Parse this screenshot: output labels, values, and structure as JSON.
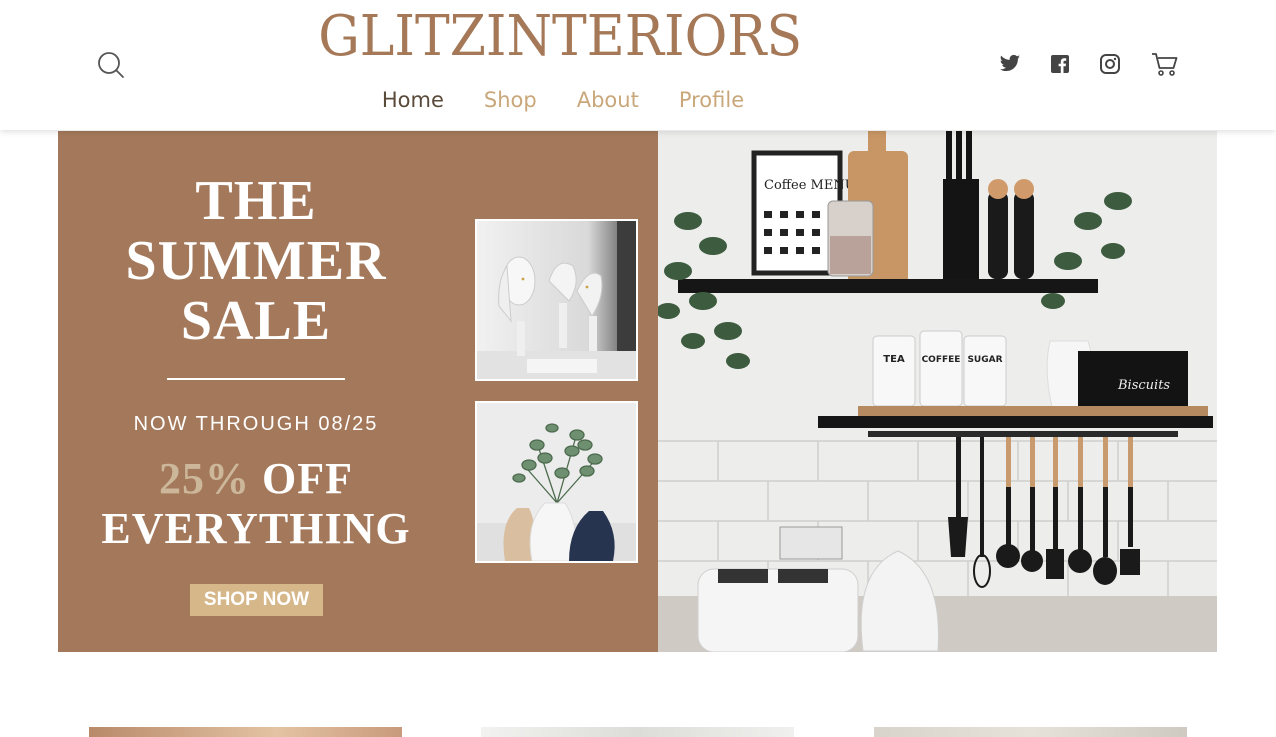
{
  "brand": {
    "logo_text": "GLITZINTERIORS"
  },
  "nav": {
    "items": [
      {
        "label": "Home",
        "active": true
      },
      {
        "label": "Shop",
        "active": false
      },
      {
        "label": "About",
        "active": false
      },
      {
        "label": "Profile",
        "active": false
      }
    ]
  },
  "header_icons": [
    "search-icon",
    "twitter-icon",
    "facebook-icon",
    "instagram-icon",
    "cart-icon"
  ],
  "hero": {
    "title_line1": "THE",
    "title_line2": "SUMMER",
    "title_line3": "SALE",
    "date_text": "NOW THROUGH 08/25",
    "offer_percent": "25%",
    "offer_off": "OFF",
    "offer_line2": "EVERYTHING",
    "cta_label": "SHOP NOW",
    "photo_labels": {
      "board_title": "Coffee MENU",
      "canister_1": "TEA",
      "canister_2": "COFFEE",
      "canister_3": "SUGAR",
      "tin": "Biscuits"
    }
  },
  "colors": {
    "brand": "#a57958",
    "hero_bg": "#a4795b",
    "nav_active": "#5a4a3a",
    "nav_inactive": "#c9a77b",
    "cta_bg": "#d5b78a",
    "offer_percent": "#cdb79b"
  }
}
